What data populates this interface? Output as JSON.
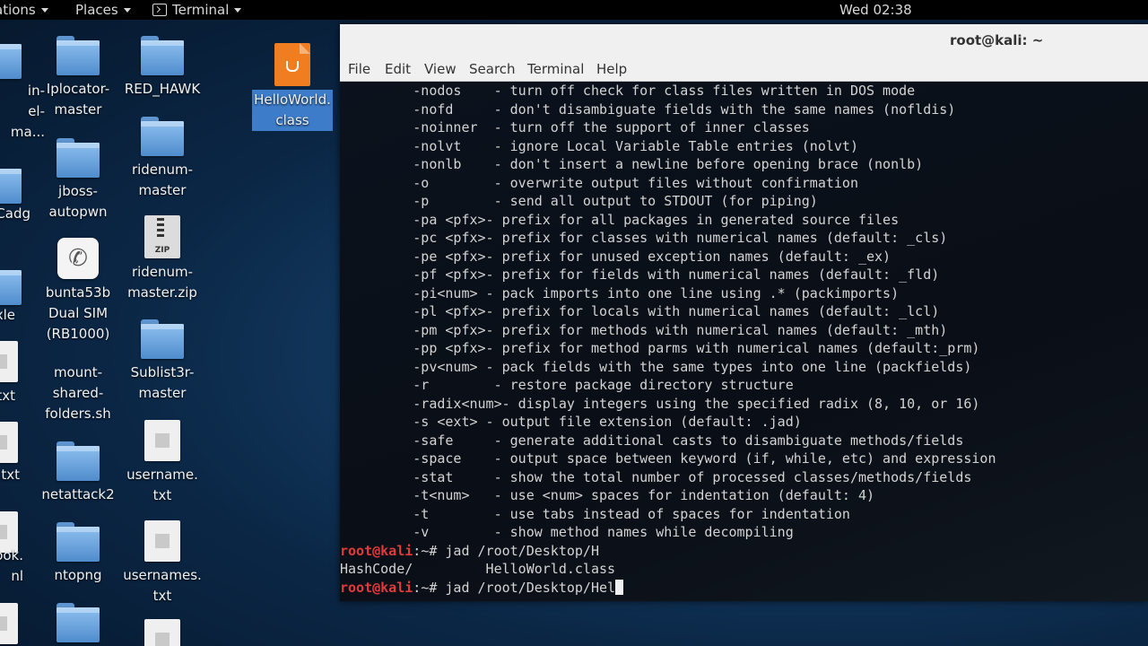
{
  "topbar": {
    "apps_label": "ations",
    "places_label": "Places",
    "terminal_label": "Terminal",
    "clock": "Wed 02:38"
  },
  "desktop": {
    "col0": [
      "in-\nel-\nma...",
      "Cadg",
      "xle",
      "txt",
      ".txt",
      "ook.\nnl"
    ],
    "col1": [
      "Iplocator-\nmaster",
      "jboss-\nautopwn",
      "bunta53b\nDual SIM\n(RB1000)",
      "mount-\nshared-\nfolders.sh",
      "netattack2",
      "ntopng"
    ],
    "col2": [
      "RED_HAWK",
      "ridenum-\nmaster",
      "ridenum-\nmaster.zip",
      "Sublist3r-\nmaster",
      "username.\ntxt",
      "usernames.\ntxt"
    ],
    "zip_badge": "ZIP",
    "selected_file": "HelloWorld.\nclass"
  },
  "terminal": {
    "title": "root@kali: ~",
    "menu": [
      "File",
      "Edit",
      "View",
      "Search",
      "Terminal",
      "Help"
    ],
    "lines": [
      "         -nodos    - turn off check for class files written in DOS mode",
      "         -nofd     - don't disambiguate fields with the same names (nofldis)",
      "         -noinner  - turn off the support of inner classes",
      "         -nolvt    - ignore Local Variable Table entries (nolvt)",
      "         -nonlb    - don't insert a newline before opening brace (nonlb)",
      "         -o        - overwrite output files without confirmation",
      "         -p        - send all output to STDOUT (for piping)",
      "         -pa <pfx>- prefix for all packages in generated source files",
      "         -pc <pfx>- prefix for classes with numerical names (default: _cls)",
      "         -pe <pfx>- prefix for unused exception names (default: _ex)",
      "         -pf <pfx>- prefix for fields with numerical names (default: _fld)",
      "         -pi<num> - pack imports into one line using .* (packimports)",
      "         -pl <pfx>- prefix for locals with numerical names (default: _lcl)",
      "         -pm <pfx>- prefix for methods with numerical names (default: _mth)",
      "         -pp <pfx>- prefix for method parms with numerical names (default:_prm)",
      "         -pv<num> - pack fields with the same types into one line (packfields)",
      "         -r        - restore package directory structure",
      "         -radix<num>- display integers using the specified radix (8, 10, or 16)",
      "         -s <ext> - output file extension (default: .jad)",
      "         -safe     - generate additional casts to disambiguate methods/fields",
      "         -space    - output space between keyword (if, while, etc) and expression",
      "         -stat     - show the total number of processed classes/methods/fields",
      "         -t<num>   - use <num> spaces for indentation (default: 4)",
      "         -t        - use tabs instead of spaces for indentation",
      "         -v        - show method names while decompiling"
    ],
    "prompt": "root@kali",
    "prompt_suffix": ":~# ",
    "cmd1": "jad /root/Desktop/H",
    "listing": "HashCode/         HelloWorld.class",
    "cmd2": "jad /root/Desktop/Hel"
  }
}
